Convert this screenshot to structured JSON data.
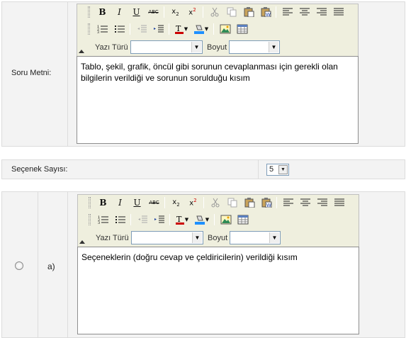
{
  "question": {
    "label": "Soru Metni:",
    "editor_text": "Tablo, şekil, grafik, öncül gibi sorunun cevaplanması için gerekli olan bilgilerin verildiği ve sorunun sorulduğu kısım"
  },
  "toolbar": {
    "font_label": "Yazı Türü",
    "font_value": "",
    "size_label": "Boyut",
    "size_value": "",
    "icons": [
      "bold-icon",
      "italic-icon",
      "underline-icon",
      "strikethrough-icon",
      "subscript-icon",
      "superscript-icon",
      "cut-icon",
      "copy-icon",
      "paste-icon",
      "paste-word-icon",
      "align-left-icon",
      "align-center-icon",
      "align-right-icon",
      "justify-icon",
      "ordered-list-icon",
      "unordered-list-icon",
      "outdent-icon",
      "indent-icon",
      "text-color-icon",
      "background-color-icon",
      "image-icon",
      "table-icon"
    ],
    "labels": {
      "bold": "B",
      "italic": "I",
      "underline": "U",
      "strike": "ABC"
    }
  },
  "options_count": {
    "label": "Seçenek Sayısı:",
    "value": "5"
  },
  "option_a": {
    "letter": "a)",
    "editor_text": "Seçeneklerin (doğru cevap ve çeldiricilerin) verildiği kısım"
  }
}
